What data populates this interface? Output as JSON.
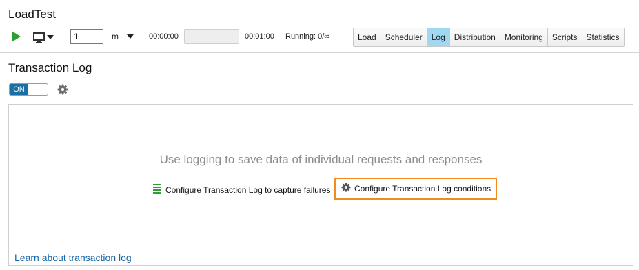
{
  "app": {
    "title": "LoadTest"
  },
  "toolbar": {
    "quantity_value": "1",
    "unit": "m",
    "elapsed": "00:00:00",
    "progress_percent": 0,
    "duration": "00:01:00",
    "running": "Running: 0/∞",
    "tabs": [
      {
        "label": "Load",
        "active": false
      },
      {
        "label": "Scheduler",
        "active": false
      },
      {
        "label": "Log",
        "active": true
      },
      {
        "label": "Distribution",
        "active": false
      },
      {
        "label": "Monitoring",
        "active": false
      },
      {
        "label": "Scripts",
        "active": false
      },
      {
        "label": "Statistics",
        "active": false
      }
    ]
  },
  "section": {
    "title": "Transaction Log",
    "toggle_label": "ON"
  },
  "panel": {
    "hint": "Use logging to save data of individual requests and responses",
    "configure_failures": "Configure Transaction Log to capture failures",
    "configure_conditions": "Configure Transaction Log conditions",
    "learn_link": "Learn about transaction log"
  },
  "colors": {
    "play_green": "#2aa034",
    "active_tab": "#9fd8f0",
    "toggle_blue": "#1a6fa3",
    "highlight_orange": "#f08c1a",
    "link_blue": "#1a67a8",
    "list_icon_green": "#2aa034"
  },
  "icons": {
    "run": "play-icon",
    "computer": "monitor-icon",
    "settings": "gear-icon",
    "list": "list-icon"
  }
}
